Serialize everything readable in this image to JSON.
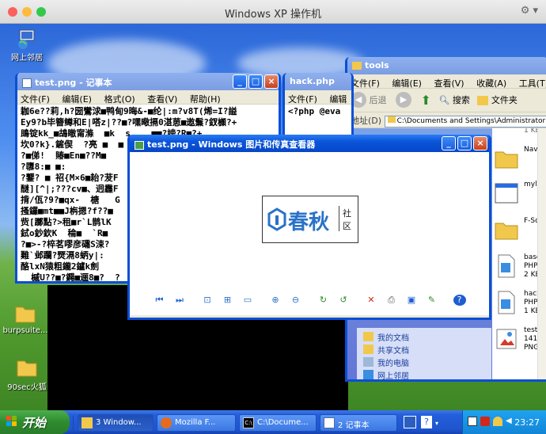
{
  "host": {
    "title": "Windows XP 操作机"
  },
  "desktop": {
    "icons": [
      {
        "label": "网上邻居"
      },
      {
        "label": "burpsuite..."
      },
      {
        "label": "90sec火狐"
      }
    ]
  },
  "notepad_main": {
    "title": "test.png - 记事本",
    "menu": [
      "文件(F)",
      "编辑(E)",
      "格式(O)",
      "查看(V)",
      "帮助(H)"
    ],
    "content": "耞6e??莉,h?圀鸞浗■鸭甸9晦&-■纶|:m?v8T(烯=I?謚\nEy9?b毕簪鳟和E|嗒z|??■?嘿曔搹0湛葸■遨鬑?釵櫇?+\n鴡锭kk_■鴣瞮甯滌  ■k  s    ■■?謗?R■?+_\n坎0?k}.鏟偰  ?亮 ■  ■ ■■  ■\n?■俤!  賰■En■??M■\n?隳8:■ ■:\n?鑋? ■ 祒{M×6■耛?茇F\n醚][^|;???cv■、迥霾F\n揹/佤?9?■qx-  榶   G\n搔鑼■mt■■J栴摁?f??■\n赀[躑點?>租■r`L鹊lK\n鉽o鈔欽K  稐■  `R■\n?■>-?椊茗嘐彦礵S涑?\n難`邺躝?燹滆8蛃y|:\n酪lxN猿粗鑨2鑪k劍\n  槭U??■?鐊■逦8■?  ?\n  (    (    ( ]y??php @"
  },
  "notepad_second": {
    "title": "hack.php",
    "menu": [
      "文件(F)",
      "编辑"
    ],
    "content": "<?php @eva"
  },
  "explorer": {
    "title": "tools",
    "menu": [
      "文件(F)",
      "编辑(E)",
      "查看(V)",
      "收藏(A)",
      "工具(T)"
    ],
    "back_label": "后退",
    "search_label": "搜索",
    "folders_label": "文件夹",
    "address_label": "地址(D)",
    "address_value": "C:\\Documents and Settings\\Administrator",
    "side_links": [
      "我的文档",
      "共享文档",
      "我的电脑",
      "网上邻居"
    ],
    "files": [
      {
        "name": "1 KB",
        "type": "top"
      },
      {
        "name": "Navi",
        "type": "folder"
      },
      {
        "name": "mylc",
        "type": "window"
      },
      {
        "name": "F-Sc",
        "type": "folder"
      },
      {
        "name": "base\nPHP\n2 KB",
        "type": "php"
      },
      {
        "name": "hack\nPHP\n1 KB",
        "type": "php"
      },
      {
        "name": "test\n141 x\nPNG",
        "type": "png"
      }
    ]
  },
  "viewer": {
    "title": "test.png - Windows 图片和传真查看器",
    "logo_main": "春秋",
    "logo_side1": "社",
    "logo_side2": "区"
  },
  "taskbar": {
    "start_label": "开始",
    "tasks": [
      {
        "label": "3 Window..."
      },
      {
        "label": "Mozilla F..."
      },
      {
        "label": "C:\\Docume..."
      },
      {
        "label": "2 记事本"
      }
    ],
    "clock": "23:27"
  },
  "colors": {
    "xp_title_blue": "#0a55d9",
    "taskbar_blue": "#245edb",
    "start_green": "#2e8b2e",
    "logo_blue": "#2a72c8"
  }
}
